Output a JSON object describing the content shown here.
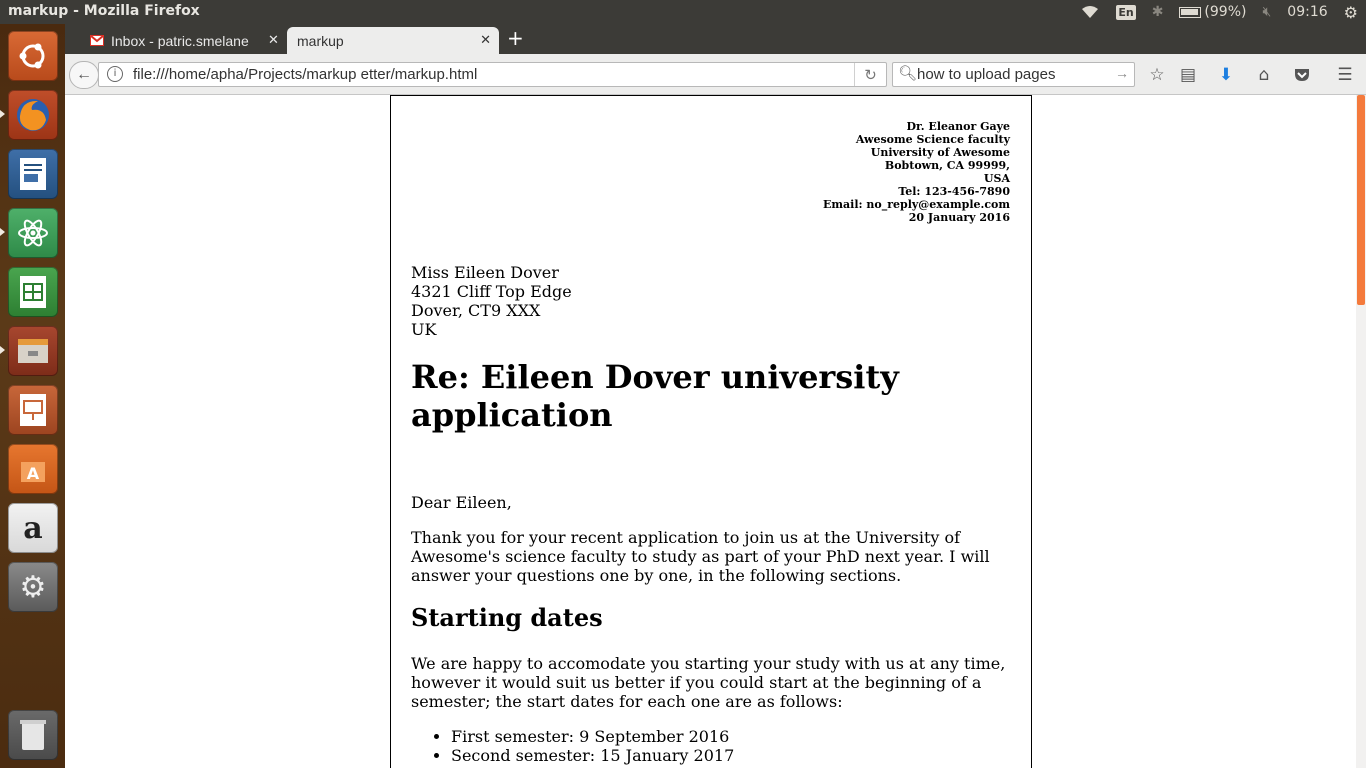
{
  "top_panel": {
    "window_title": "markup - Mozilla Firefox",
    "keyboard_layout": "En",
    "battery": "(99%)",
    "clock": "09:16"
  },
  "browser": {
    "tabs": [
      {
        "label": "Inbox - patric.smelane",
        "active": false
      },
      {
        "label": "markup",
        "active": true
      }
    ],
    "url": "file:///home/apha/Projects/markup etter/markup.html",
    "search_query": "how to upload pages"
  },
  "launcher": {
    "apps": [
      "ubuntu-dash-icon",
      "firefox-icon",
      "writer-icon",
      "atom-icon",
      "calc-icon",
      "files-icon",
      "impress-icon",
      "software-center-icon",
      "amazon-icon",
      "system-settings-icon",
      "trash-icon"
    ]
  },
  "letter": {
    "sender": {
      "name": "Dr. Eleanor Gaye",
      "dept": "Awesome Science faculty",
      "univ": "University of Awesome",
      "city": "Bobtown, CA 99999,",
      "country": "USA",
      "tel": "Tel: 123-456-7890",
      "email": "Email: no_reply@example.com",
      "date": "20 January 2016"
    },
    "recipient": {
      "name": "Miss Eileen Dover",
      "street": "4321 Cliff Top Edge",
      "city": "Dover, CT9 XXX",
      "country": "UK"
    },
    "headline": "Re: Eileen Dover university application",
    "greeting": "Dear Eileen,",
    "intro": "Thank you for your recent application to join us at the University of Awesome's science faculty to study as part of your PhD next year. I will answer your questions one by one, in the following sections.",
    "section_title": "Starting dates",
    "section_text": "We are happy to accomodate you starting your study with us at any time, however it would suit us better if you could start at the beginning of a semester; the start dates for each one are as follows:",
    "dates": [
      "First semester: 9 September 2016",
      "Second semester: 15 January 2017"
    ]
  }
}
